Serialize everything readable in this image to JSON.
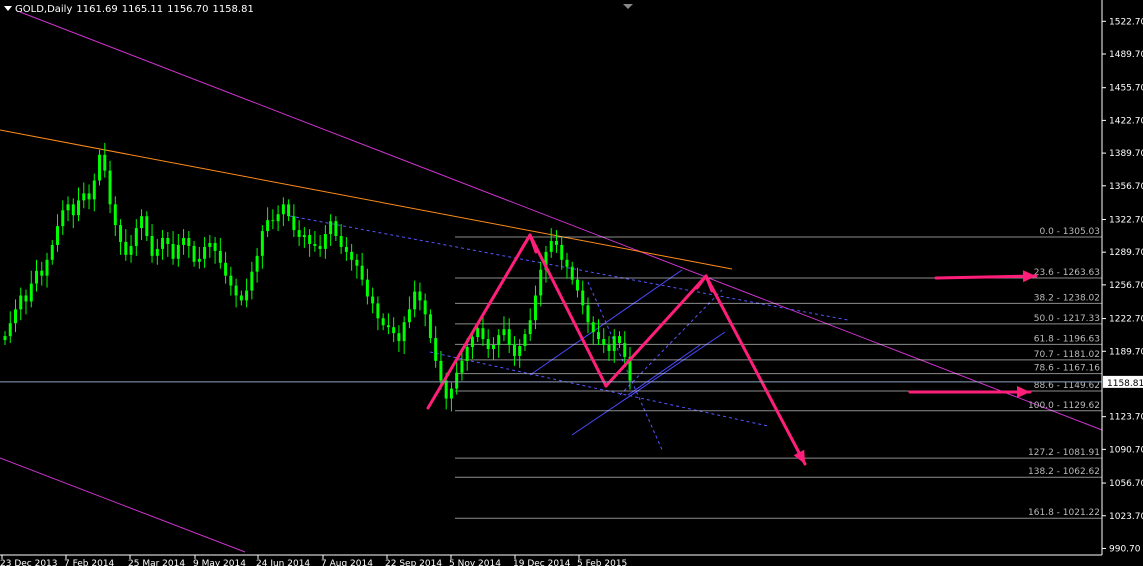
{
  "header": {
    "symbol": "GOLD,Daily",
    "open": "1161.69",
    "high": "1165.11",
    "low": "1156.70",
    "close": "1158.81"
  },
  "colors": {
    "background": "#000000",
    "candle": "#00ff00",
    "axis": "#ffffff",
    "fib": "#b9b9b9",
    "fibGrid": "#ffffff",
    "channel": "#cc33cc",
    "orangeTrend": "#ff8c1a",
    "dashed": "#5656ff",
    "pitch": "#4a4aff",
    "pattern": "#ff1f7a",
    "priceLine": "#8fa3c0",
    "priceBadgeBg": "#ffffff",
    "priceBadgeText": "#000000"
  },
  "chart_data": {
    "type": "candlestick",
    "instrument": "GOLD",
    "timeframe": "Daily",
    "current_price": "1158.81",
    "price_ticks": [
      "1522.70",
      "1489.70",
      "1455.70",
      "1422.70",
      "1389.70",
      "1356.70",
      "1322.70",
      "1289.70",
      "1256.70",
      "1222.70",
      "1189.70",
      "1158.81",
      "1123.70",
      "1090.70",
      "1056.70",
      "1023.70",
      "990.70"
    ],
    "date_ticks": [
      "23 Dec 2013",
      "7 Feb 2014",
      "25 Mar 2014",
      "9 May 2014",
      "24 Jun 2014",
      "7 Aug 2014",
      "22 Sep 2014",
      "5 Nov 2014",
      "19 Dec 2014",
      "5 Feb 2015"
    ],
    "price_range": [
      980,
      1535
    ],
    "fib_levels": [
      {
        "label": "0.0 - 1305.03",
        "price": 1305.03
      },
      {
        "label": "23.6 - 1263.63",
        "price": 1263.63
      },
      {
        "label": "38.2 - 1238.02",
        "price": 1238.02
      },
      {
        "label": "50.0 - 1217.33",
        "price": 1217.33
      },
      {
        "label": "61.8 - 1196.63",
        "price": 1196.63
      },
      {
        "label": "70.7 - 1181.02",
        "price": 1181.02
      },
      {
        "label": "78.6 - 1167.16",
        "price": 1167.16
      },
      {
        "label": "88.6 - 1149.62",
        "price": 1149.62
      },
      {
        "label": "100.0 - 1129.62",
        "price": 1129.62
      },
      {
        "label": "127.2 - 1081.91",
        "price": 1081.91
      },
      {
        "label": "138.2 - 1062.62",
        "price": 1062.62
      },
      {
        "label": "161.8 - 1021.22",
        "price": 1021.22
      }
    ],
    "closes": [
      1205,
      1218,
      1232,
      1246,
      1240,
      1258,
      1271,
      1266,
      1282,
      1297,
      1316,
      1332,
      1338,
      1327,
      1342,
      1349,
      1343,
      1362,
      1388,
      1372,
      1338,
      1317,
      1300,
      1287,
      1296,
      1314,
      1326,
      1306,
      1286,
      1293,
      1304,
      1298,
      1283,
      1297,
      1304,
      1296,
      1280,
      1283,
      1295,
      1299,
      1291,
      1279,
      1266,
      1256,
      1246,
      1241,
      1251,
      1270,
      1286,
      1311,
      1322,
      1321,
      1328,
      1338,
      1326,
      1312,
      1305,
      1307,
      1298,
      1296,
      1293,
      1308,
      1321,
      1306,
      1295,
      1290,
      1282,
      1276,
      1262,
      1245,
      1238,
      1223,
      1216,
      1214,
      1208,
      1200,
      1219,
      1232,
      1250,
      1241,
      1227,
      1203,
      1180,
      1160,
      1142,
      1152,
      1168,
      1180,
      1194,
      1204,
      1213,
      1202,
      1192,
      1196,
      1206,
      1212,
      1196,
      1185,
      1195,
      1207,
      1221,
      1246,
      1272,
      1290,
      1301,
      1297,
      1282,
      1275,
      1262,
      1251,
      1236,
      1219,
      1209,
      1202,
      1196,
      1190,
      1205,
      1198,
      1184,
      1160
    ]
  }
}
